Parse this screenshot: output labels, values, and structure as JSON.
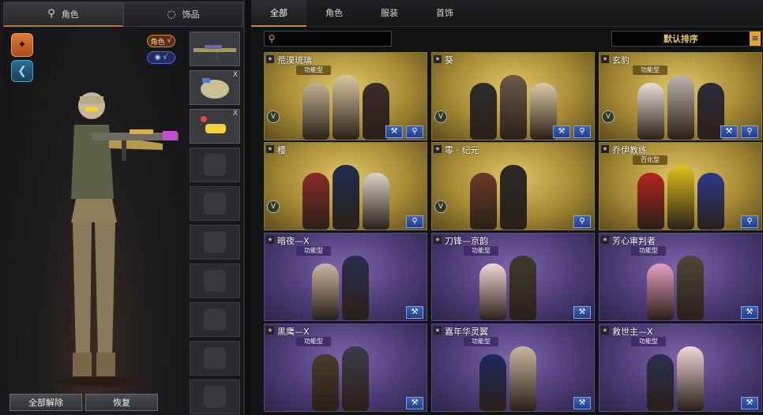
{
  "left_tabs": [
    {
      "label": "角色",
      "icon": "character-icon",
      "active": true
    },
    {
      "label": "饰品",
      "icon": "ring-icon",
      "active": false
    }
  ],
  "toggles": [
    {
      "label": "角色",
      "check": "√",
      "color": "#d48a46"
    },
    {
      "label": "◉",
      "check": "√",
      "color": "#5468d4"
    }
  ],
  "bottom_buttons": {
    "clear_all": "全部解除",
    "restore": "恢复"
  },
  "category_tabs": [
    "全部",
    "角色",
    "服装",
    "首饰"
  ],
  "search": {
    "placeholder": "",
    "icon": "search-icon"
  },
  "sort": {
    "label": "默认排序",
    "icon": "menu-icon"
  },
  "slot_close": "X",
  "cards": [
    {
      "name": "荒漠琉璃",
      "style": "gold",
      "type": "功能型",
      "v": "V",
      "buttons": [
        "wrench-icon",
        "search-icon"
      ]
    },
    {
      "name": "葵",
      "style": "gold",
      "type": "",
      "v": "V",
      "buttons": [
        "wrench-icon",
        "search-icon"
      ]
    },
    {
      "name": "玄豹",
      "style": "gold",
      "type": "功能型",
      "v": "V",
      "buttons": [
        "wrench-icon",
        "search-icon"
      ]
    },
    {
      "name": "樱",
      "style": "gold",
      "type": "",
      "v": "V",
      "buttons": [
        "search-icon"
      ]
    },
    {
      "name": "零 · 纪元",
      "style": "gold",
      "type": "",
      "v": "V",
      "buttons": [
        "search-icon"
      ]
    },
    {
      "name": "乔伊教练",
      "style": "gold",
      "type": "百化型",
      "v": "",
      "buttons": [
        "search-icon"
      ]
    },
    {
      "name": "暗夜—X",
      "style": "purple",
      "type": "功能型",
      "v": "",
      "buttons": [
        "wrench-icon"
      ]
    },
    {
      "name": "刀锋—京韵",
      "style": "purple",
      "type": "功能型",
      "v": "",
      "buttons": [
        "wrench-icon"
      ]
    },
    {
      "name": "芳心审判者",
      "style": "purple",
      "type": "功能型",
      "v": "",
      "buttons": [
        "wrench-icon"
      ]
    },
    {
      "name": "黑鹰—X",
      "style": "purple",
      "type": "功能型",
      "v": "",
      "buttons": [
        "wrench-icon"
      ]
    },
    {
      "name": "嘉年华灵翼",
      "style": "purple",
      "type": "功能型",
      "v": "",
      "buttons": [
        "wrench-icon"
      ]
    },
    {
      "name": "救世主—X",
      "style": "purple",
      "type": "功能型",
      "v": "",
      "buttons": [
        "wrench-icon"
      ]
    }
  ],
  "colors": {
    "accent": "#c98934",
    "gold": "#a68a35",
    "purple": "#4d3c77",
    "button_blue": "#3e62b6"
  }
}
